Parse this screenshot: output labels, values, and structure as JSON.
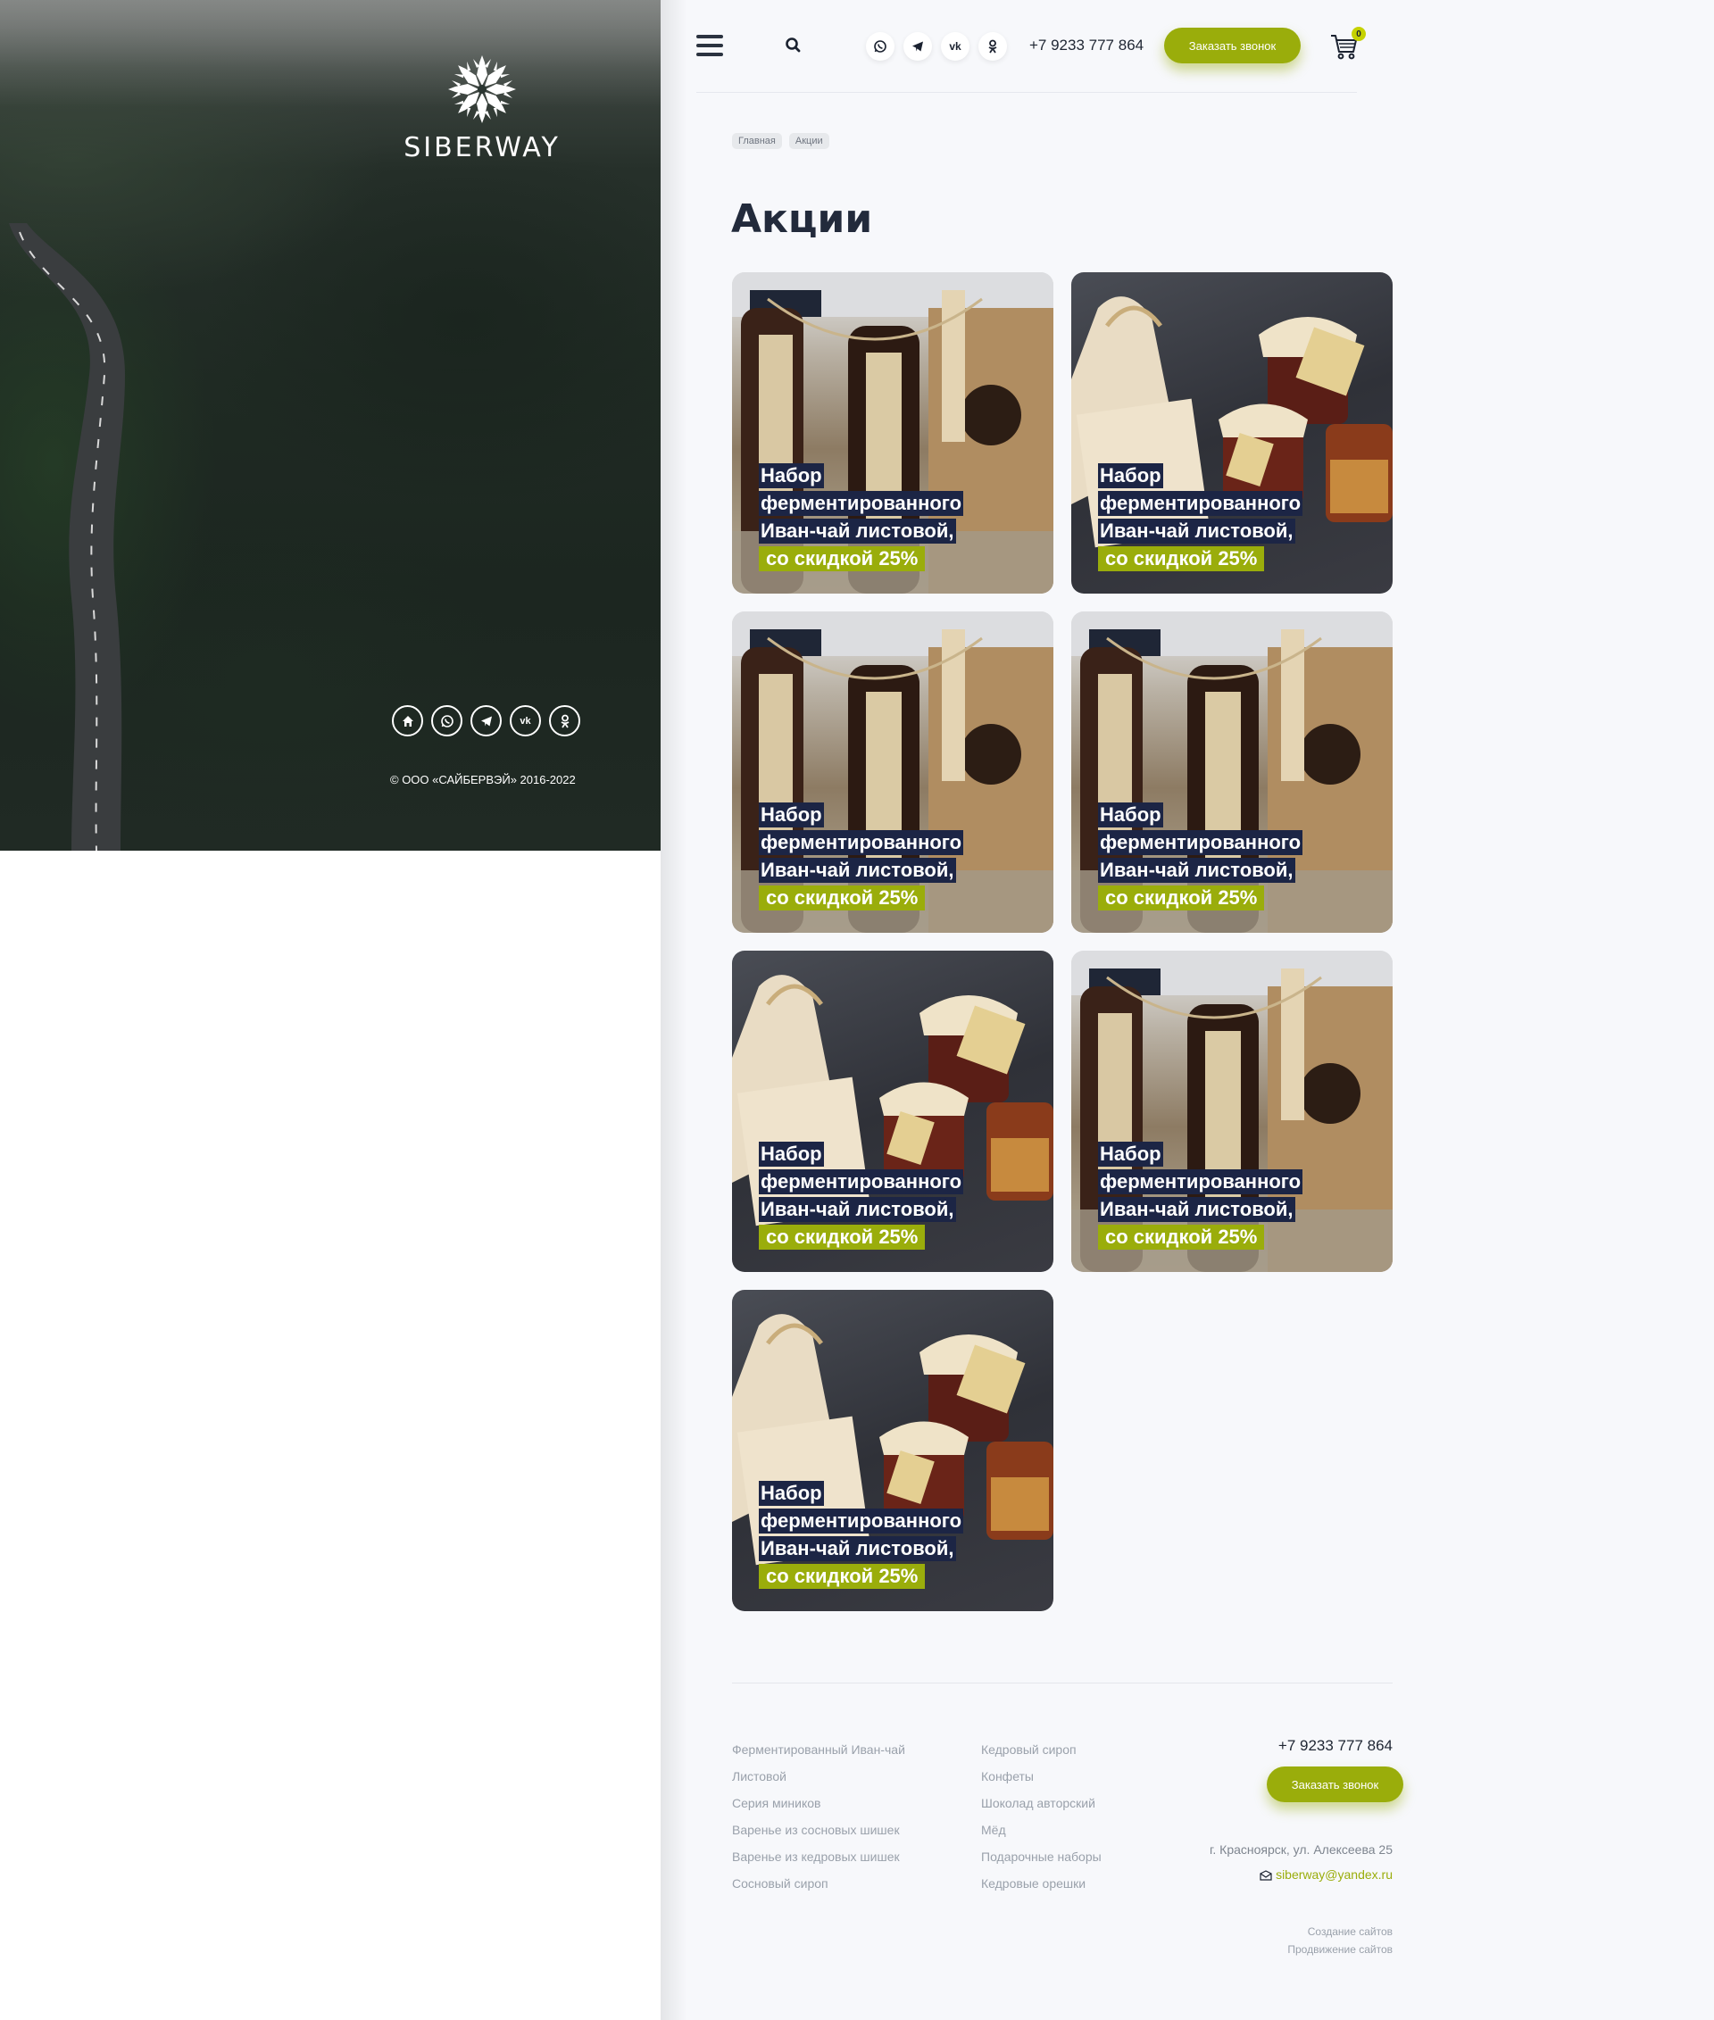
{
  "brand": {
    "name": "SIBERWAY"
  },
  "hero": {
    "social": [
      "home-icon",
      "whatsapp-icon",
      "telegram-icon",
      "vk-icon",
      "odnoklassniki-icon"
    ],
    "copyright": "© ООО «САЙБЕРВЭЙ» 2016-2022"
  },
  "header": {
    "social": [
      "whatsapp-icon",
      "telegram-icon",
      "vk-icon",
      "odnoklassniki-icon"
    ],
    "phone": "+7 9233 777 864",
    "call_button": "Заказать звонок",
    "cart_count": "0"
  },
  "breadcrumb": [
    "Главная",
    "Акции"
  ],
  "page_title": "Акции",
  "promos": [
    {
      "line1": "Набор",
      "line2": "ферментированного",
      "line3": "Иван-чай листовой,",
      "line4": "со скидкой 25%"
    },
    {
      "line1": "Набор",
      "line2": "ферментированного",
      "line3": "Иван-чай листовой,",
      "line4": "со скидкой 25%"
    },
    {
      "line1": "Набор",
      "line2": "ферментированного",
      "line3": "Иван-чай листовой,",
      "line4": "со скидкой 25%"
    },
    {
      "line1": "Набор",
      "line2": "ферментированного",
      "line3": "Иван-чай листовой,",
      "line4": "со скидкой 25%"
    },
    {
      "line1": "Набор",
      "line2": "ферментированного",
      "line3": "Иван-чай листовой,",
      "line4": "со скидкой 25%"
    },
    {
      "line1": "Набор",
      "line2": "ферментированного",
      "line3": "Иван-чай листовой,",
      "line4": "со скидкой 25%"
    },
    {
      "line1": "Набор",
      "line2": "ферментированного",
      "line3": "Иван-чай листовой,",
      "line4": "со скидкой 25%"
    }
  ],
  "footer": {
    "col1": [
      "Ферментированный Иван-чай",
      "Листовой",
      "Серия миников",
      "Варенье из сосновых шишек",
      "Варенье из кедровых шишек",
      "Сосновый сироп"
    ],
    "col2": [
      "Кедровый сироп",
      "Конфеты",
      "Шоколад авторский",
      "Мёд",
      "Подарочные наборы",
      "Кедровые орешки"
    ],
    "phone": "+7 9233 777 864",
    "call_button": "Заказать звонок",
    "address": "г. Красноярск, ул. Алексеева 25",
    "email": "siberway@yandex.ru",
    "dev_links": [
      "Создание сайтов",
      "Продвижение сайтов"
    ]
  },
  "colors": {
    "accent": "#9aad0b",
    "caption_bg": "#1c2545",
    "title": "#222a3b"
  }
}
